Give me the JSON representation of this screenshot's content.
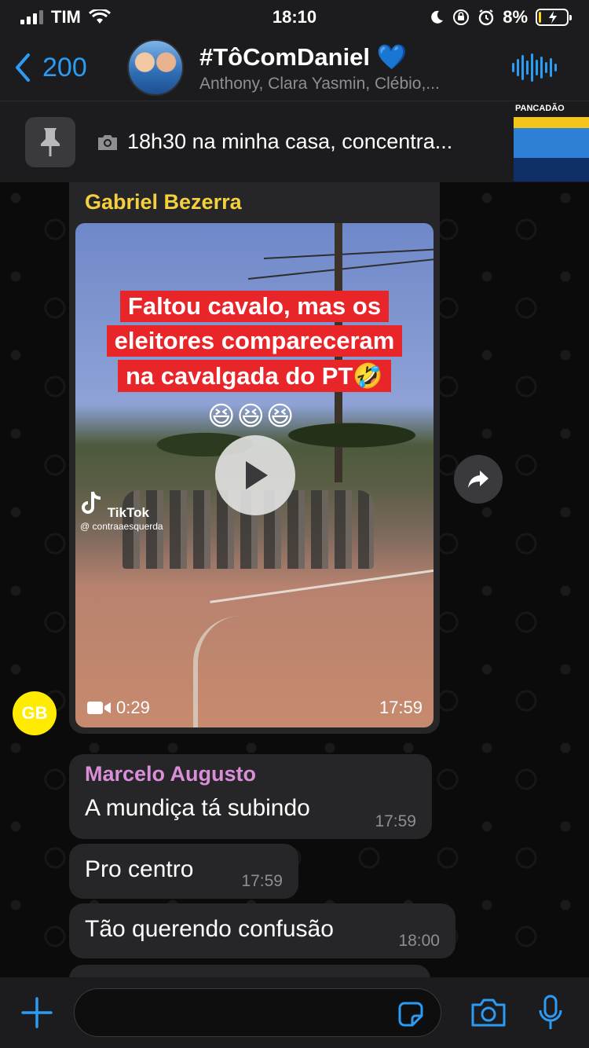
{
  "status_bar": {
    "carrier": "TIM",
    "time": "18:10",
    "battery_percent": "8%",
    "battery_level": 0.08
  },
  "header": {
    "back_count": "200",
    "group_name": "#TôComDaniel 💙",
    "members": "Anthony, Clara Yasmin, Clébio,..."
  },
  "pinned": {
    "text": "18h30 na minha casa, concentra...",
    "thumb_label": "PANCADÃO"
  },
  "messages": {
    "video": {
      "sender": "Gabriel Bezerra",
      "caption_lines": [
        "Faltou cavalo, mas os",
        "eleitores compareceram",
        "na cavalgada do PT🤣"
      ],
      "emojis": "😆😆😆",
      "watermark_brand": "TikTok",
      "watermark_handle": "@ contraaesquerda",
      "duration": "0:29",
      "time": "17:59",
      "avatar_initials": "GB"
    },
    "m1": {
      "sender": "Marcelo Augusto",
      "text": "A mundiça tá subindo",
      "time": "17:59"
    },
    "m2": {
      "text": "Pro centro",
      "time": "17:59"
    },
    "m3": {
      "text": "Tão querendo confusão",
      "time": "18:00"
    }
  },
  "colors": {
    "accent": "#2b9bf4",
    "sender_gabriel": "#f4d03f",
    "sender_marcelo": "#d98fd8",
    "bubble": "#262628"
  },
  "icons": {
    "back": "chevron-left-icon",
    "audio": "audio-wave-icon",
    "pin": "pin-icon",
    "camera": "camera-icon",
    "play": "play-icon",
    "forward": "forward-icon",
    "plus": "plus-icon",
    "sticker": "sticker-icon",
    "mic": "microphone-icon"
  }
}
